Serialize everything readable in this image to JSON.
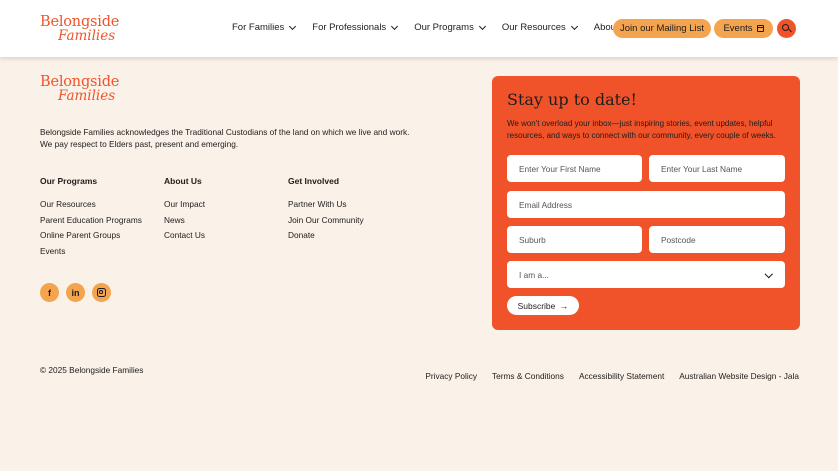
{
  "brand": {
    "line1": "Belongside",
    "line2": "Families",
    "color": "#f0532a"
  },
  "nav": {
    "items": [
      {
        "label": "For Families"
      },
      {
        "label": "For Professionals"
      },
      {
        "label": "Our Programs"
      },
      {
        "label": "Our Resources"
      },
      {
        "label": "About Us"
      }
    ],
    "mailing_label": "Join our Mailing List",
    "events_label": "Events"
  },
  "footer": {
    "acknowledgement_1": "Belongside Families acknowledges the Traditional Custodians of the land on which we live and work.",
    "acknowledgement_2": "We pay respect to Elders past, present and emerging.",
    "columns": [
      {
        "title": "Our Programs",
        "links": [
          "Our Resources",
          "Parent Education Programs",
          "Online Parent Groups",
          "Events"
        ]
      },
      {
        "title": "About Us",
        "links": [
          "Our Impact",
          "News",
          "Contact Us"
        ]
      },
      {
        "title": "Get Involved",
        "links": [
          "Partner With Us",
          "Join Our Community",
          "Donate"
        ]
      }
    ],
    "socials": [
      "f",
      "in",
      "instagram"
    ],
    "copyright": "© 2025 Belongside Families",
    "legal_links": [
      "Privacy Policy",
      "Terms & Conditions",
      "Accessibility Statement",
      "Australian Website Design - Jala"
    ]
  },
  "newsletter": {
    "title": "Stay up to date!",
    "description": "We won't overload your inbox—just inspiring stories, event updates, helpful resources, and ways to connect with our community, every couple of weeks.",
    "first_name_placeholder": "Enter Your First Name",
    "last_name_placeholder": "Enter Your Last Name",
    "email_placeholder": "Email Address",
    "suburb_placeholder": "Suburb",
    "postcode_placeholder": "Postcode",
    "select_value": "I am a...",
    "subscribe_label": "Subscribe",
    "card_color": "#f0532a"
  },
  "colors": {
    "accent": "#f0532a",
    "pill": "#f4a44f",
    "background": "#faf1e8"
  }
}
